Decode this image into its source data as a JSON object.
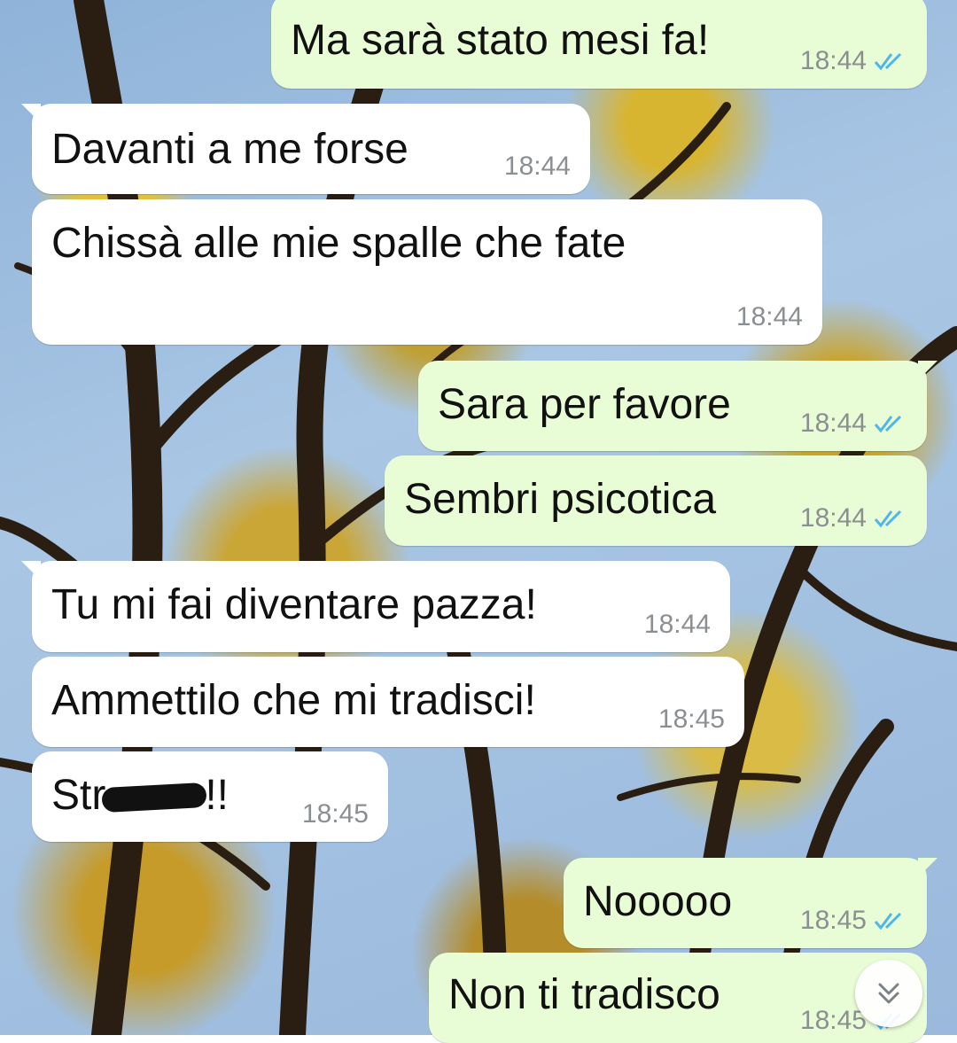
{
  "chat": {
    "messages": [
      {
        "direction": "out",
        "text": "Ma sarà stato mesi fa!",
        "time": "18:44",
        "status": "read"
      },
      {
        "direction": "in",
        "text": "Davanti a me forse",
        "time": "18:44"
      },
      {
        "direction": "in",
        "text": "Chissà alle mie spalle che fate",
        "time": "18:44"
      },
      {
        "direction": "out",
        "text": "Sara per favore",
        "time": "18:44",
        "status": "read"
      },
      {
        "direction": "out",
        "text": "Sembri psicotica",
        "time": "18:44",
        "status": "read"
      },
      {
        "direction": "in",
        "text": "Tu mi fai diventare pazza!",
        "time": "18:44"
      },
      {
        "direction": "in",
        "text": "Ammettilo che mi tradisci!",
        "time": "18:45"
      },
      {
        "direction": "in",
        "text_prefix": "Str",
        "text_suffix": "!!",
        "redacted": true,
        "time": "18:45"
      },
      {
        "direction": "out",
        "text": "Nooooo",
        "time": "18:45",
        "status": "read"
      },
      {
        "direction": "out",
        "text": "Non ti tradisco",
        "time": "18:45",
        "status": "read"
      }
    ]
  },
  "scroll_to_bottom": {
    "icon": "double-chevron-down-icon"
  },
  "colors": {
    "incoming_bubble": "#ffffff",
    "outgoing_bubble": "#e8fcd6",
    "read_ticks": "#4fb6ec",
    "timestamp": "#8b8f92"
  }
}
